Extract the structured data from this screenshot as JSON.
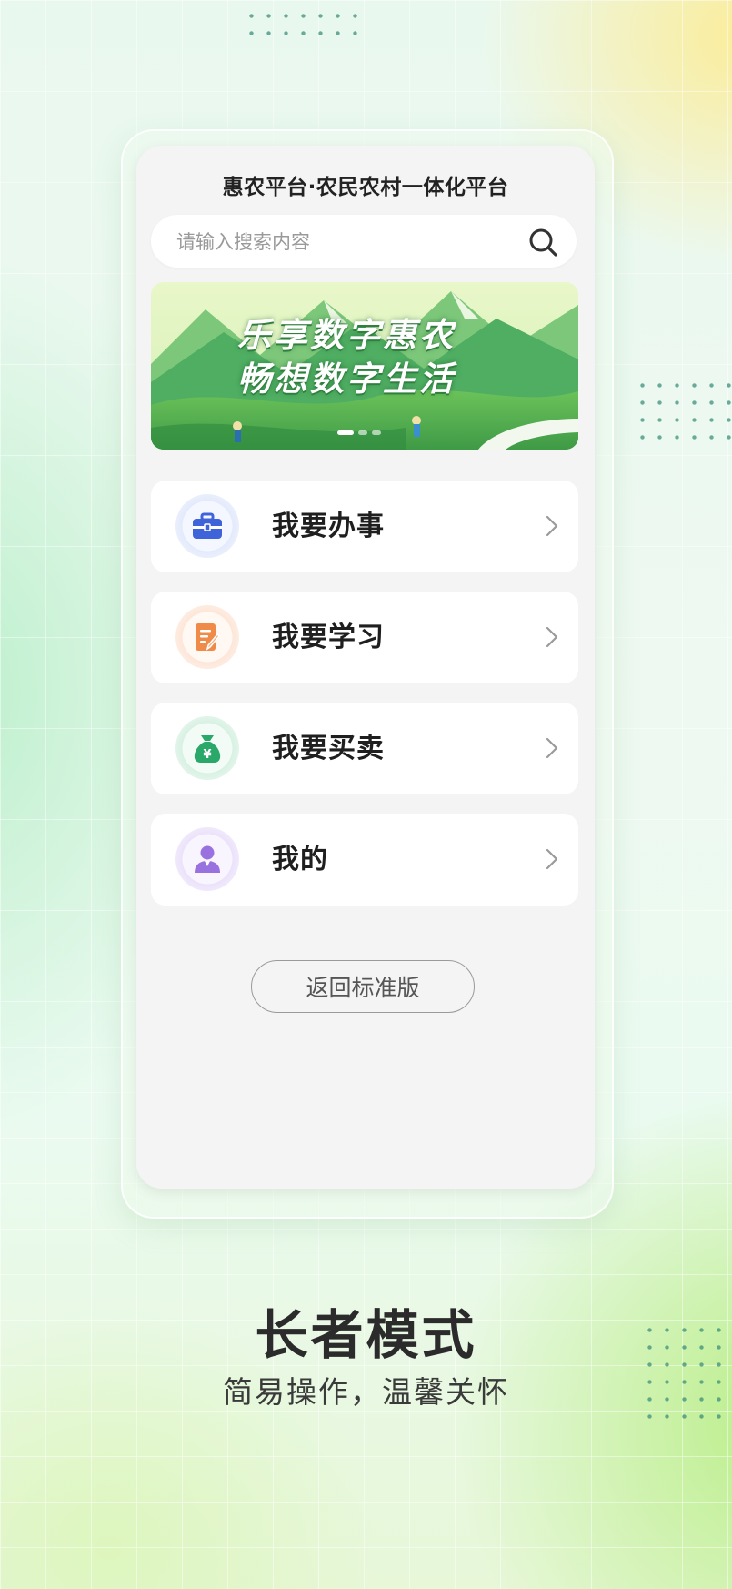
{
  "app": {
    "title": "惠农平台·农民农村一体化平台"
  },
  "search": {
    "placeholder": "请输入搜索内容",
    "value": ""
  },
  "banner": {
    "line1": "乐享数字惠农",
    "line2": "畅想数字生活",
    "pages": 3,
    "active_page": 1
  },
  "menu": [
    {
      "label": "我要办事",
      "icon": "briefcase-icon",
      "color": "#3f63d8",
      "ring": "#dde6fb"
    },
    {
      "label": "我要学习",
      "icon": "document-edit-icon",
      "color": "#f08a48",
      "ring": "#fde6d8"
    },
    {
      "label": "我要买卖",
      "icon": "money-bag-icon",
      "color": "#2aa86a",
      "ring": "#d8f1e3"
    },
    {
      "label": "我的",
      "icon": "user-icon",
      "color": "#9a72e0",
      "ring": "#ebe2fa"
    }
  ],
  "actions": {
    "back_to_standard": "返回标准版"
  },
  "promo": {
    "title": "长者模式",
    "subtitle": "简易操作，温馨关怀"
  },
  "colors": {
    "chevron": "#9a9a9a",
    "search_icon": "#333333"
  }
}
